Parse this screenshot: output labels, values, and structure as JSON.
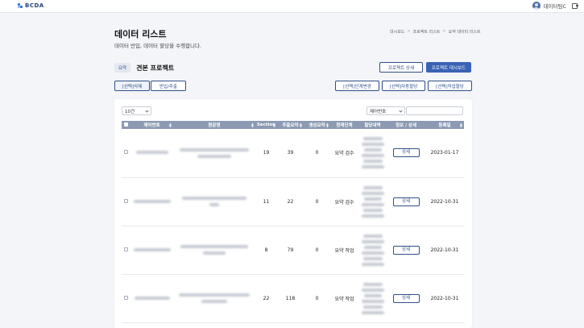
{
  "header": {
    "brand": "BCDA",
    "user_name": "데이터팀C"
  },
  "page": {
    "title": "데이터 리스트",
    "subtitle": "데이터 반입, 데이터 할당을 수행합니다.",
    "breadcrumb": [
      "대시보드",
      "프로젝트 리스트",
      "요약 데이터 리스트"
    ]
  },
  "project": {
    "badge": "요약",
    "name": "견본 프로젝트"
  },
  "top_buttons": {
    "project_detail": "프로젝트 상세",
    "project_dashboard": "프로젝트 대시보드"
  },
  "left_actions": {
    "delete_selected": "[선택]삭제",
    "import": "반입/추출"
  },
  "right_actions": {
    "change_status": "[선택]단계변경",
    "auto_assign": "[선택]자동할당",
    "assign_worker": "[선택]작업할당"
  },
  "table_controls": {
    "page_size": "10건",
    "filter_field": "제어번호",
    "search_value": ""
  },
  "columns": [
    "제어번호",
    "원문명",
    "Section",
    "추출요약",
    "생성요약",
    "현재단계",
    "할당내역",
    "정보 / 상세",
    "등록일"
  ],
  "rows": [
    {
      "section": "19",
      "extract": "39",
      "generated": "0",
      "stage": "요약 검수",
      "detail": "상세",
      "date": "2023-01-17"
    },
    {
      "section": "11",
      "extract": "22",
      "generated": "0",
      "stage": "요약 검수",
      "detail": "상세",
      "date": "2022-10-31"
    },
    {
      "section": "8",
      "extract": "79",
      "generated": "0",
      "stage": "요약 작업",
      "detail": "상세",
      "date": "2022-10-31"
    },
    {
      "section": "22",
      "extract": "118",
      "generated": "0",
      "stage": "요약 작업",
      "detail": "상세",
      "date": "2022-10-31"
    }
  ],
  "colors": {
    "primary": "#3a63b5",
    "header_bg": "#8c9ab3",
    "page_bg": "#f3f5f9"
  }
}
